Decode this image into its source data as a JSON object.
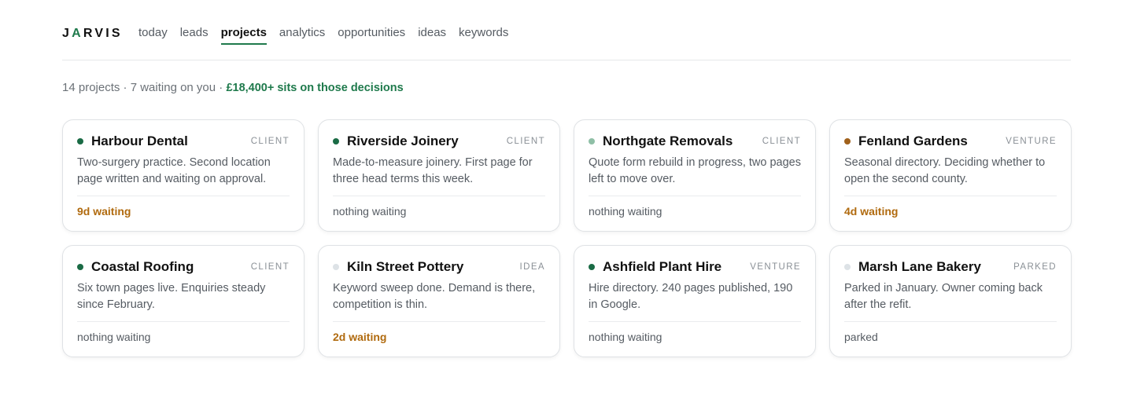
{
  "brand": {
    "pre": "J",
    "accent": "A",
    "post": "RVIS"
  },
  "nav": [
    {
      "label": "today",
      "active": false
    },
    {
      "label": "leads",
      "active": false
    },
    {
      "label": "projects",
      "active": true
    },
    {
      "label": "analytics",
      "active": false
    },
    {
      "label": "opportunities",
      "active": false
    },
    {
      "label": "ideas",
      "active": false
    },
    {
      "label": "keywords",
      "active": false
    }
  ],
  "summary": {
    "text": "14 projects · 7 waiting on you · ",
    "highlight": "£18,400+ sits on those decisions"
  },
  "colors": {
    "accent": "#1f7a4c",
    "dot_green": "#1a6b45",
    "dot_light_green": "#8fbfa6",
    "dot_amber": "#a0611b",
    "dot_grey": "#dde2e6",
    "waiting_text": "#b06a0e"
  },
  "projects": [
    {
      "name": "Harbour Dental",
      "tag": "CLIENT",
      "dot": "#1a6b45",
      "description": "Two-surgery practice. Second location page written and waiting on approval.",
      "status": "9d waiting",
      "waiting": true
    },
    {
      "name": "Riverside Joinery",
      "tag": "CLIENT",
      "dot": "#1a6b45",
      "description": "Made-to-measure joinery. First page for three head terms this week.",
      "status": "nothing waiting",
      "waiting": false
    },
    {
      "name": "Northgate Removals",
      "tag": "CLIENT",
      "dot": "#8fbfa6",
      "description": "Quote form rebuild in progress, two pages left to move over.",
      "status": "nothing waiting",
      "waiting": false
    },
    {
      "name": "Fenland Gardens",
      "tag": "VENTURE",
      "dot": "#a0611b",
      "description": "Seasonal directory. Deciding whether to open the second county.",
      "status": "4d waiting",
      "waiting": true
    },
    {
      "name": "Coastal Roofing",
      "tag": "CLIENT",
      "dot": "#1a6b45",
      "description": "Six town pages live. Enquiries steady since February.",
      "status": "nothing waiting",
      "waiting": false
    },
    {
      "name": "Kiln Street Pottery",
      "tag": "IDEA",
      "dot": "#dde2e6",
      "description": "Keyword sweep done. Demand is there, competition is thin.",
      "status": "2d waiting",
      "waiting": true
    },
    {
      "name": "Ashfield Plant Hire",
      "tag": "VENTURE",
      "dot": "#1a6b45",
      "description": "Hire directory. 240 pages published, 190 in Google.",
      "status": "nothing waiting",
      "waiting": false
    },
    {
      "name": "Marsh Lane Bakery",
      "tag": "PARKED",
      "dot": "#dde2e6",
      "description": "Parked in January. Owner coming back after the refit.",
      "status": "parked",
      "waiting": false
    }
  ]
}
